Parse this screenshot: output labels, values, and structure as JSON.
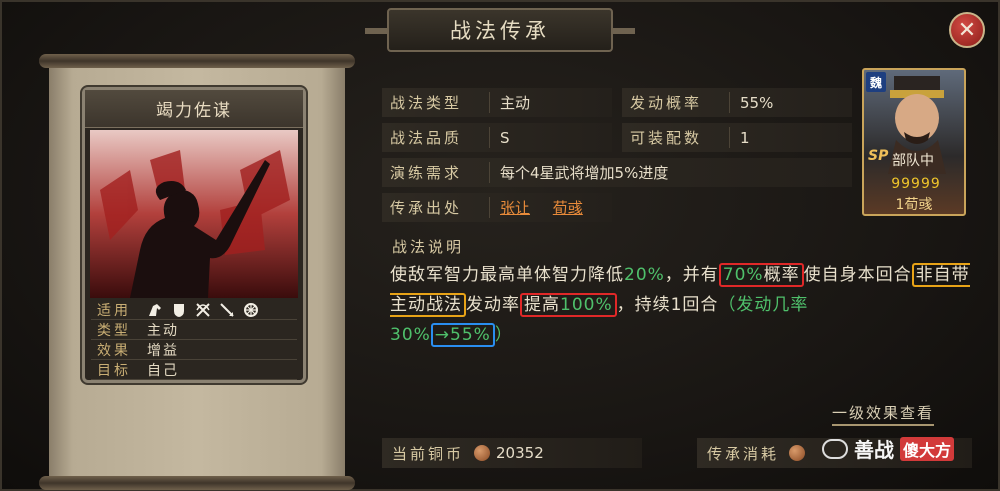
{
  "title": "战法传承",
  "card": {
    "name": "竭力佐谋",
    "attributes": [
      {
        "label": "适用",
        "value": ""
      },
      {
        "label": "类型",
        "value": "主动"
      },
      {
        "label": "效果",
        "value": "增益"
      },
      {
        "label": "目标",
        "value": "自己"
      }
    ],
    "unit_icons": [
      "cavalry-icon",
      "shield-icon",
      "bow-icon",
      "spear-icon",
      "wheel-icon"
    ]
  },
  "info": {
    "type_label": "战法类型",
    "type_value": "主动",
    "rate_label": "发动概率",
    "rate_value": "55%",
    "quality_label": "战法品质",
    "quality_value": "S",
    "equip_label": "可装配数",
    "equip_value": "1",
    "training_label": "演练需求",
    "training_value": "每个4星武将增加5%进度",
    "source_label": "传承出处",
    "source_values": [
      "张让",
      "荀彧"
    ]
  },
  "portrait": {
    "faction": "魏",
    "sp": "SP",
    "unit": "部队中",
    "stars": "99999",
    "name": "1荀彧"
  },
  "description": {
    "title": "战法说明",
    "t1": "使敌军智力最高单体智力降低",
    "v1": "20%",
    "t2": "，并有",
    "v2": "70%",
    "t3": "概率",
    "t4": "使自身本回合",
    "t5": "非自带主动战法",
    "t6": "发动率",
    "t7": "提高",
    "v3": "100%",
    "t8": "，",
    "t9": "持续1回合",
    "n1": "（发动几率",
    "n2": "30%",
    "n3": "→",
    "n4": "55%",
    "n5": "）"
  },
  "level_link": "一级效果查看",
  "bottom": {
    "coin_label": "当前铜币",
    "coin_value": "20352",
    "cost_label": "传承消耗"
  },
  "watermark": {
    "text": "善战",
    "badge": "傻大方"
  },
  "colors": {
    "highlight_green": "#4fc06b",
    "box_red": "#e02828",
    "box_yellow": "#e8a317",
    "box_blue": "#2a8ef0",
    "source_link": "#e98b3a"
  }
}
